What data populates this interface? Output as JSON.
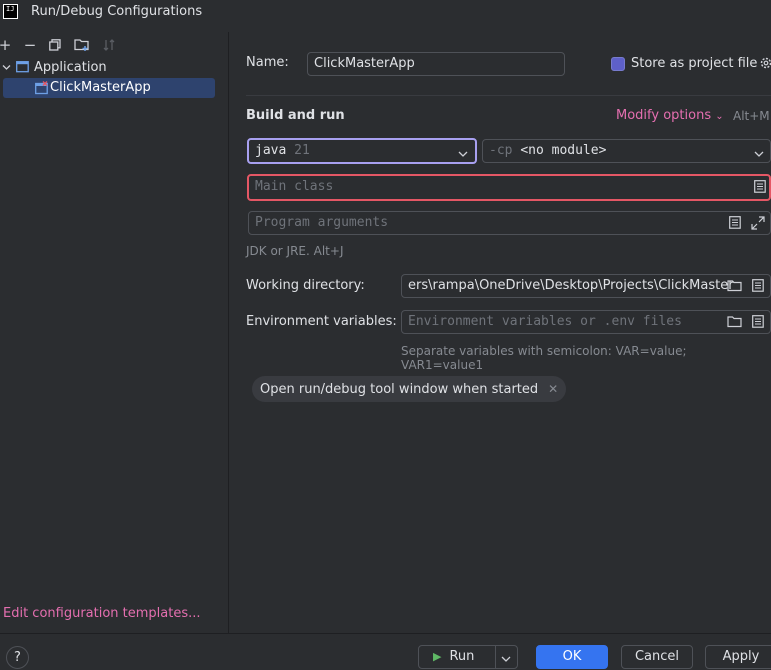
{
  "window": {
    "title": "Run/Debug Configurations",
    "app_logo_text": "IJ"
  },
  "tree": {
    "group_label": "Application",
    "selected_item": "ClickMasterApp",
    "edit_templates_link": "Edit configuration templates..."
  },
  "form": {
    "name_label": "Name:",
    "name_value": "ClickMasterApp",
    "store_label": "Store as project file",
    "section_title": "Build and run",
    "modify_options": "Modify options",
    "modify_shortcut": "Alt+M",
    "jdk_name": "java",
    "jdk_version": "21",
    "cp_prefix": "-cp",
    "cp_value": "<no module>",
    "main_class_placeholder": "Main class",
    "program_args_placeholder": "Program arguments",
    "jdk_hint": "JDK or JRE. Alt+J",
    "working_dir_label": "Working directory:",
    "working_dir_value": "ers\\rampa\\OneDrive\\Desktop\\Projects\\ClickMaster",
    "env_label": "Environment variables:",
    "env_placeholder": "Environment variables or .env files",
    "env_hint": "Separate variables with semicolon: VAR=value; VAR1=value1",
    "chip_label": "Open run/debug tool window when started"
  },
  "buttons": {
    "help": "?",
    "run": "Run",
    "ok": "OK",
    "cancel": "Cancel",
    "apply": "Apply"
  },
  "colors": {
    "accent": "#3574f0",
    "link": "#e56fb0",
    "error_border": "#e55765",
    "focus_border": "#a8a0f0"
  }
}
